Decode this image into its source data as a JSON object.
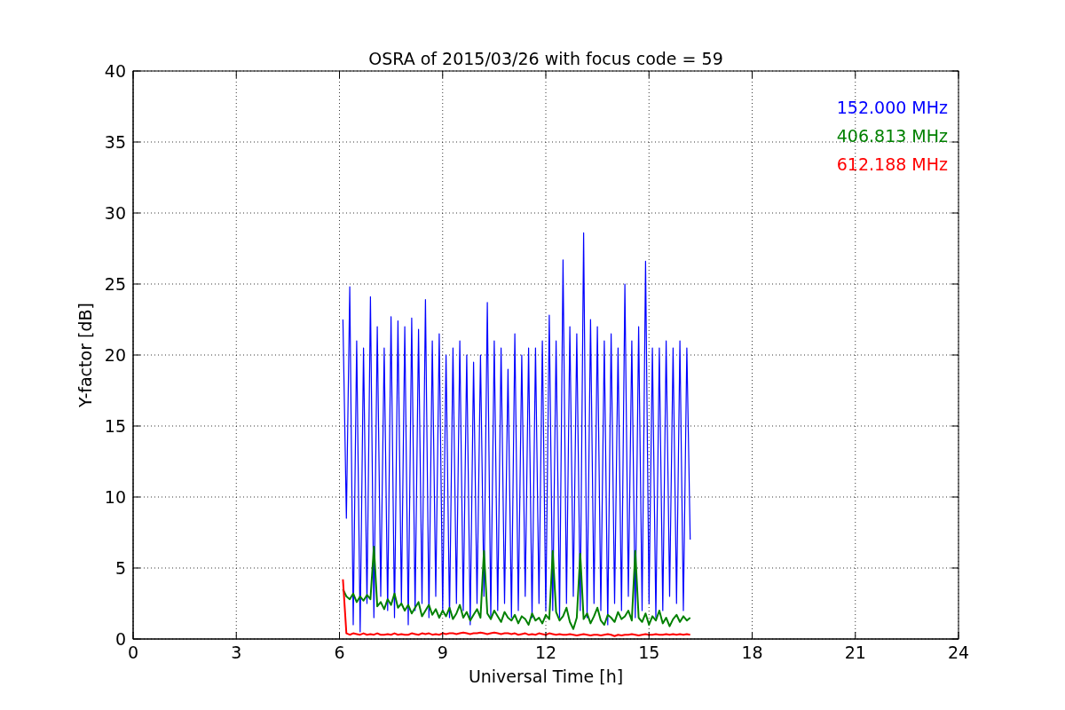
{
  "chart_data": {
    "type": "line",
    "title": "OSRA of 2015/03/26 with focus code = 59",
    "xlabel": "Universal Time [h]",
    "ylabel": "Y-factor [dB]",
    "xlim": [
      0,
      24
    ],
    "ylim": [
      0,
      40
    ],
    "grid": true,
    "xticks": [
      0,
      3,
      6,
      9,
      12,
      15,
      18,
      21,
      24
    ],
    "yticks": [
      0,
      5,
      10,
      15,
      20,
      25,
      30,
      35,
      40
    ],
    "x": [
      6.1,
      6.2,
      6.3,
      6.4,
      6.5,
      6.6,
      6.7,
      6.8,
      6.9,
      7.0,
      7.1,
      7.2,
      7.3,
      7.4,
      7.5,
      7.6,
      7.7,
      7.8,
      7.9,
      8.0,
      8.1,
      8.2,
      8.3,
      8.4,
      8.5,
      8.6,
      8.7,
      8.8,
      8.9,
      9.0,
      9.1,
      9.2,
      9.3,
      9.4,
      9.5,
      9.6,
      9.7,
      9.8,
      9.9,
      10.0,
      10.1,
      10.2,
      10.3,
      10.4,
      10.5,
      10.6,
      10.7,
      10.8,
      10.9,
      11.0,
      11.1,
      11.2,
      11.3,
      11.4,
      11.5,
      11.6,
      11.7,
      11.8,
      11.9,
      12.0,
      12.1,
      12.2,
      12.3,
      12.4,
      12.5,
      12.6,
      12.7,
      12.8,
      12.9,
      13.0,
      13.1,
      13.2,
      13.3,
      13.4,
      13.5,
      13.6,
      13.7,
      13.8,
      13.9,
      14.0,
      14.1,
      14.2,
      14.3,
      14.4,
      14.5,
      14.6,
      14.7,
      14.8,
      14.9,
      15.0,
      15.1,
      15.2,
      15.3,
      15.4,
      15.5,
      15.6,
      15.7,
      15.8,
      15.9,
      16.0,
      16.1,
      16.2
    ],
    "series": [
      {
        "name": "152.000 MHz",
        "color": "#0000ff",
        "values": [
          22.5,
          8.5,
          24.8,
          1,
          21,
          0.5,
          20.5,
          2.5,
          24.1,
          1.5,
          22,
          3,
          20.5,
          2,
          22.7,
          1.5,
          22.4,
          2.5,
          22,
          1,
          22.6,
          2,
          21.8,
          2.5,
          23.9,
          1.5,
          21,
          3,
          21.5,
          2,
          20,
          1.5,
          20.5,
          2.5,
          21,
          2,
          20,
          1,
          19.5,
          2.5,
          20,
          3,
          23.7,
          1.5,
          21,
          2,
          20.5,
          2.5,
          19,
          1.5,
          21.5,
          2,
          20,
          3,
          20.5,
          1.5,
          20.5,
          2.5,
          21,
          2,
          22.8,
          2,
          21,
          1.5,
          26.7,
          2.5,
          22,
          3,
          21.5,
          2,
          28.6,
          1.5,
          22.5,
          2.5,
          22,
          2,
          21,
          1,
          21.5,
          2.5,
          20.5,
          2,
          25,
          3,
          21,
          1.5,
          22,
          2,
          26.6,
          2.5,
          20.5,
          1.5,
          20.5,
          2,
          21,
          3,
          20.5,
          2.5,
          21,
          2,
          20.5,
          7
        ]
      },
      {
        "name": "406.813 MHz",
        "color": "#008000",
        "values": [
          3.5,
          3,
          2.8,
          3.2,
          2.6,
          3,
          2.7,
          3.1,
          2.8,
          6.5,
          2.3,
          2.6,
          2.1,
          2.8,
          2.4,
          3.2,
          2.2,
          2.5,
          2.0,
          2.4,
          1.8,
          2.2,
          2.6,
          1.6,
          2.0,
          2.4,
          1.7,
          2.1,
          1.5,
          2.0,
          1.6,
          2.2,
          1.4,
          1.8,
          2.4,
          1.5,
          1.9,
          1.3,
          1.7,
          2.1,
          1.5,
          6.2,
          1.8,
          1.4,
          2.0,
          1.6,
          1.2,
          1.9,
          1.5,
          1.3,
          1.7,
          1.1,
          1.6,
          1.4,
          1.0,
          1.8,
          1.3,
          1.5,
          1.1,
          1.7,
          1.4,
          6.2,
          1.9,
          1.3,
          1.6,
          2.2,
          1.2,
          0.7,
          1.5,
          6.0,
          1.4,
          1.8,
          1.1,
          1.6,
          2.2,
          1.3,
          1.0,
          1.7,
          1.5,
          1.2,
          1.9,
          1.4,
          1.6,
          2.0,
          1.3,
          6.2,
          1.5,
          1.2,
          1.8,
          1.0,
          1.6,
          1.3,
          2.0,
          1.1,
          1.5,
          0.9,
          1.4,
          1.7,
          1.2,
          1.6,
          1.3,
          1.5
        ]
      },
      {
        "name": "612.188 MHz",
        "color": "#ff0000",
        "values": [
          4.2,
          0.4,
          0.3,
          0.4,
          0.35,
          0.3,
          0.4,
          0.3,
          0.35,
          0.3,
          0.4,
          0.3,
          0.3,
          0.35,
          0.3,
          0.4,
          0.3,
          0.35,
          0.3,
          0.3,
          0.4,
          0.35,
          0.3,
          0.4,
          0.35,
          0.4,
          0.3,
          0.35,
          0.3,
          0.4,
          0.35,
          0.4,
          0.4,
          0.35,
          0.4,
          0.45,
          0.4,
          0.35,
          0.4,
          0.4,
          0.45,
          0.4,
          0.35,
          0.4,
          0.45,
          0.4,
          0.35,
          0.4,
          0.4,
          0.35,
          0.4,
          0.3,
          0.35,
          0.4,
          0.3,
          0.35,
          0.3,
          0.4,
          0.35,
          0.3,
          0.4,
          0.35,
          0.3,
          0.35,
          0.3,
          0.3,
          0.35,
          0.3,
          0.25,
          0.3,
          0.35,
          0.3,
          0.25,
          0.3,
          0.3,
          0.25,
          0.3,
          0.35,
          0.3,
          0.2,
          0.3,
          0.25,
          0.3,
          0.3,
          0.35,
          0.3,
          0.25,
          0.3,
          0.35,
          0.3,
          0.3,
          0.35,
          0.3,
          0.3,
          0.35,
          0.3,
          0.35,
          0.3,
          0.35,
          0.3,
          0.35,
          0.3
        ]
      }
    ]
  }
}
